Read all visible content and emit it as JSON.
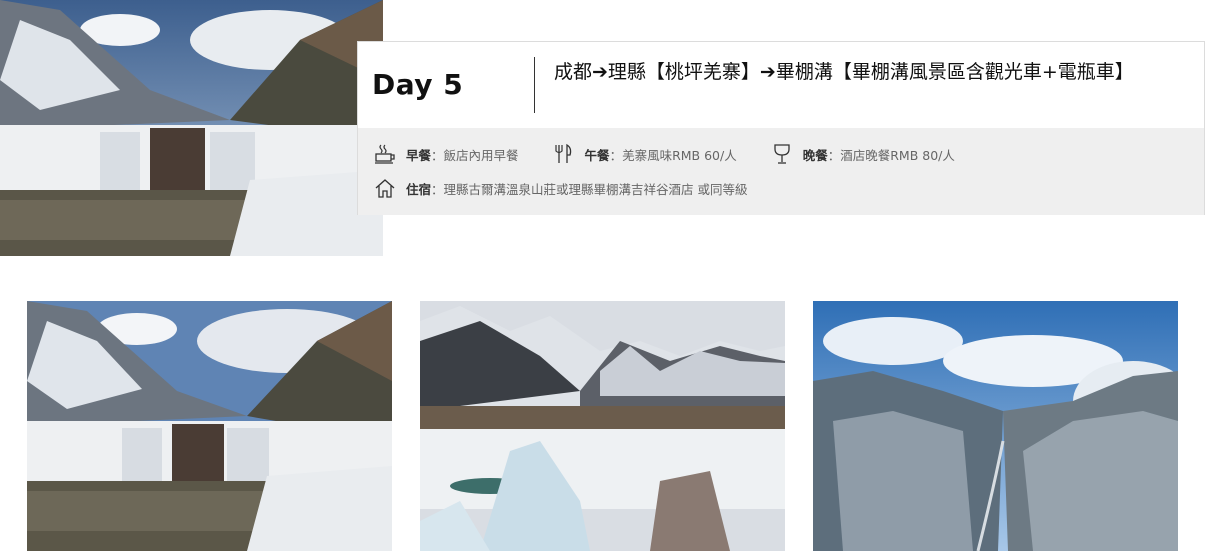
{
  "day": {
    "label": "Day 5",
    "route": "成都➔理縣【桃坪羌寨】➔畢棚溝【畢棚溝風景區含觀光車+電瓶車】"
  },
  "meals": {
    "breakfast": {
      "label": "早餐",
      "sep": "：",
      "value": "飯店內用早餐"
    },
    "lunch": {
      "label": "午餐",
      "sep": "：",
      "value": "羌寨風味RMB 60/人"
    },
    "dinner": {
      "label": "晚餐",
      "sep": "：",
      "value": "酒店晚餐RMB 80/人"
    }
  },
  "lodging": {
    "label": "住宿",
    "sep": "：",
    "value": "理縣古爾溝溫泉山莊或理縣畢棚溝吉祥谷酒店 或同等級"
  },
  "icons": {
    "breakfast": "coffee-cup-icon",
    "lunch": "fork-knife-icon",
    "dinner": "wine-glass-icon",
    "lodging": "house-icon"
  },
  "images": [
    "waterfall-photo",
    "frozen-lake-photo",
    "aerial-valley-photo"
  ]
}
